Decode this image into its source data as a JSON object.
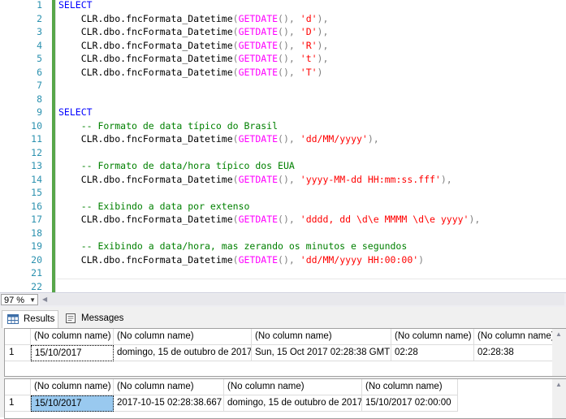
{
  "editor": {
    "line_numbers": [
      "1",
      "2",
      "3",
      "4",
      "5",
      "6",
      "7",
      "8",
      "9",
      "10",
      "11",
      "12",
      "13",
      "14",
      "15",
      "16",
      "17",
      "18",
      "19",
      "20",
      "21",
      "22"
    ],
    "lines": [
      [
        {
          "t": "SELECT",
          "k": "kw"
        }
      ],
      [
        {
          "t": "    CLR.dbo.fncFormata_Datetime",
          "k": ""
        },
        {
          "t": "(",
          "k": "gr"
        },
        {
          "t": "GETDATE",
          "k": "fn"
        },
        {
          "t": "(),",
          "k": "gr"
        },
        {
          "t": " ",
          "k": ""
        },
        {
          "t": "'d'",
          "k": "st"
        },
        {
          "t": "),",
          "k": "gr"
        }
      ],
      [
        {
          "t": "    CLR.dbo.fncFormata_Datetime",
          "k": ""
        },
        {
          "t": "(",
          "k": "gr"
        },
        {
          "t": "GETDATE",
          "k": "fn"
        },
        {
          "t": "(),",
          "k": "gr"
        },
        {
          "t": " ",
          "k": ""
        },
        {
          "t": "'D'",
          "k": "st"
        },
        {
          "t": "),",
          "k": "gr"
        }
      ],
      [
        {
          "t": "    CLR.dbo.fncFormata_Datetime",
          "k": ""
        },
        {
          "t": "(",
          "k": "gr"
        },
        {
          "t": "GETDATE",
          "k": "fn"
        },
        {
          "t": "(),",
          "k": "gr"
        },
        {
          "t": " ",
          "k": ""
        },
        {
          "t": "'R'",
          "k": "st"
        },
        {
          "t": "),",
          "k": "gr"
        }
      ],
      [
        {
          "t": "    CLR.dbo.fncFormata_Datetime",
          "k": ""
        },
        {
          "t": "(",
          "k": "gr"
        },
        {
          "t": "GETDATE",
          "k": "fn"
        },
        {
          "t": "(),",
          "k": "gr"
        },
        {
          "t": " ",
          "k": ""
        },
        {
          "t": "'t'",
          "k": "st"
        },
        {
          "t": "),",
          "k": "gr"
        }
      ],
      [
        {
          "t": "    CLR.dbo.fncFormata_Datetime",
          "k": ""
        },
        {
          "t": "(",
          "k": "gr"
        },
        {
          "t": "GETDATE",
          "k": "fn"
        },
        {
          "t": "(),",
          "k": "gr"
        },
        {
          "t": " ",
          "k": ""
        },
        {
          "t": "'T'",
          "k": "st"
        },
        {
          "t": ")",
          "k": "gr"
        }
      ],
      [],
      [],
      [
        {
          "t": "SELECT",
          "k": "kw"
        }
      ],
      [
        {
          "t": "    -- Formato de data típico do Brasil",
          "k": "cm"
        }
      ],
      [
        {
          "t": "    CLR.dbo.fncFormata_Datetime",
          "k": ""
        },
        {
          "t": "(",
          "k": "gr"
        },
        {
          "t": "GETDATE",
          "k": "fn"
        },
        {
          "t": "(),",
          "k": "gr"
        },
        {
          "t": " ",
          "k": ""
        },
        {
          "t": "'dd/MM/yyyy'",
          "k": "st"
        },
        {
          "t": "),",
          "k": "gr"
        }
      ],
      [],
      [
        {
          "t": "    -- Formato de data/hora típico dos EUA",
          "k": "cm"
        }
      ],
      [
        {
          "t": "    CLR.dbo.fncFormata_Datetime",
          "k": ""
        },
        {
          "t": "(",
          "k": "gr"
        },
        {
          "t": "GETDATE",
          "k": "fn"
        },
        {
          "t": "(),",
          "k": "gr"
        },
        {
          "t": " ",
          "k": ""
        },
        {
          "t": "'yyyy-MM-dd HH:mm:ss.fff'",
          "k": "st"
        },
        {
          "t": "),",
          "k": "gr"
        }
      ],
      [],
      [
        {
          "t": "    -- Exibindo a data por extenso",
          "k": "cm"
        }
      ],
      [
        {
          "t": "    CLR.dbo.fncFormata_Datetime",
          "k": ""
        },
        {
          "t": "(",
          "k": "gr"
        },
        {
          "t": "GETDATE",
          "k": "fn"
        },
        {
          "t": "(),",
          "k": "gr"
        },
        {
          "t": " ",
          "k": ""
        },
        {
          "t": "'dddd, dd \\d\\e MMMM \\d\\e yyyy'",
          "k": "st"
        },
        {
          "t": "),",
          "k": "gr"
        }
      ],
      [],
      [
        {
          "t": "    -- Exibindo a data/hora, mas zerando os minutos e segundos",
          "k": "cm"
        }
      ],
      [
        {
          "t": "    CLR.dbo.fncFormata_Datetime",
          "k": ""
        },
        {
          "t": "(",
          "k": "gr"
        },
        {
          "t": "GETDATE",
          "k": "fn"
        },
        {
          "t": "(),",
          "k": "gr"
        },
        {
          "t": " ",
          "k": ""
        },
        {
          "t": "'dd/MM/yyyy HH:00:00'",
          "k": "st"
        },
        {
          "t": ")",
          "k": "gr"
        }
      ],
      [],
      []
    ]
  },
  "zoom": {
    "value": "97 %"
  },
  "tabs": {
    "results": "Results",
    "messages": "Messages"
  },
  "grid1": {
    "headers": [
      "",
      "(No column name)",
      "(No column name)",
      "(No column name)",
      "(No column name)",
      "(No column name)"
    ],
    "rows": [
      [
        "1",
        "15/10/2017",
        "domingo, 15 de outubro de 2017",
        "Sun, 15 Oct 2017 02:28:38 GMT",
        "02:28",
        "02:28:38"
      ]
    ]
  },
  "grid2": {
    "headers": [
      "",
      "(No column name)",
      "(No column name)",
      "(No column name)",
      "(No column name)"
    ],
    "rows": [
      [
        "1",
        "15/10/2017",
        "2017-10-15 02:28:38.667",
        "domingo, 15 de outubro de 2017",
        "15/10/2017 02:00:00"
      ]
    ]
  },
  "colors": {
    "keyword": "#0000ff",
    "function": "#ff00ff",
    "string": "#ff0000",
    "comment": "#008000",
    "line_number": "#2b91af",
    "selected_cell": "#99c9ef"
  }
}
